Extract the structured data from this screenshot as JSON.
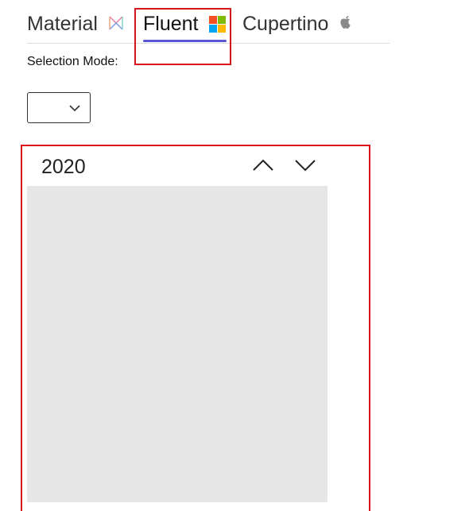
{
  "tabs": [
    {
      "label": "Material",
      "icon": "material-icon",
      "selected": false
    },
    {
      "label": "Fluent",
      "icon": "windows-logo-icon",
      "selected": true
    },
    {
      "label": "Cupertino",
      "icon": "apple-logo-icon",
      "selected": false
    }
  ],
  "selection_mode": {
    "label": "Selection Mode:",
    "value": ""
  },
  "calendar": {
    "year": "2020"
  },
  "colors": {
    "tab_underline": "#5b54d6",
    "highlight_border": "#d9141b",
    "calendar_body": "#e6e6e6",
    "windows_red": "#f25022",
    "windows_green": "#7fba00",
    "windows_blue": "#00a4ef",
    "windows_yellow": "#ffb900"
  }
}
